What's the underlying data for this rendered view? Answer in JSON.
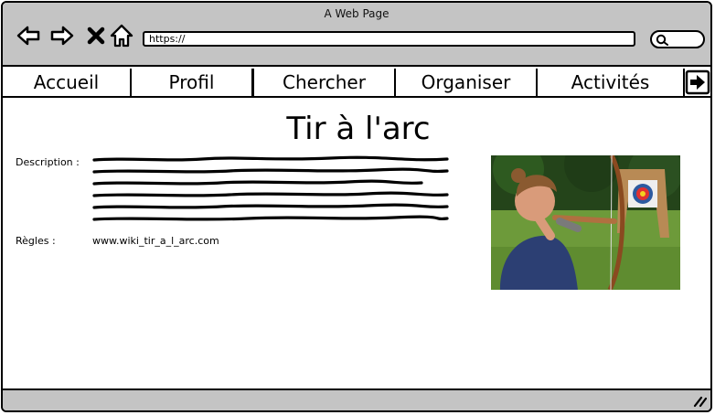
{
  "window": {
    "title": "A Web Page"
  },
  "address_bar": {
    "url": "https://"
  },
  "menu": {
    "items": [
      {
        "label": "Accueil"
      },
      {
        "label": "Profil"
      },
      {
        "label": "Chercher"
      },
      {
        "label": "Organiser"
      },
      {
        "label": "Activités"
      }
    ]
  },
  "page": {
    "title": "Tir à l'arc",
    "description_label": "Description :",
    "rules_label": "Règles :",
    "rules_link": "www.wiki_tir_a_l_arc.com"
  },
  "icons": {
    "back": "arrow-left-icon",
    "forward": "arrow-right-icon",
    "stop": "close-icon",
    "home": "home-icon",
    "search": "search-icon",
    "logout": "logout-icon",
    "resize": "resize-grip-icon"
  },
  "colors": {
    "chrome": "#c4c4c4",
    "border": "#000000",
    "background": "#ffffff"
  }
}
